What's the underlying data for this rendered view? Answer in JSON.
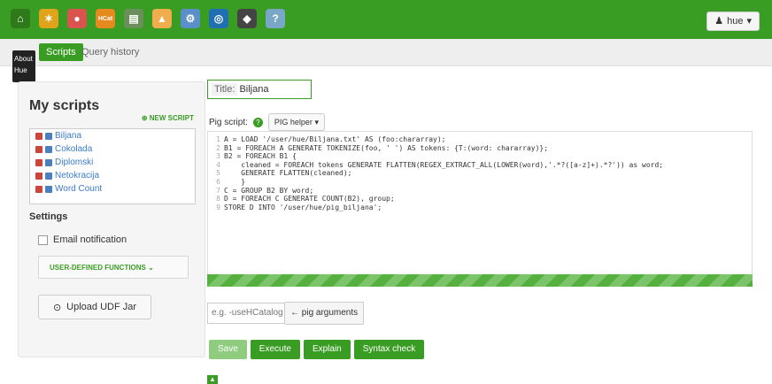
{
  "topbar": {
    "apps": [
      {
        "name": "hue-home-icon",
        "color": "#2e7a1a",
        "glyph": "⌂"
      },
      {
        "name": "beeswax-icon",
        "color": "#e0a31c",
        "glyph": "✶"
      },
      {
        "name": "pig-icon",
        "color": "#d9534f",
        "glyph": "●"
      },
      {
        "name": "hcat-icon",
        "color": "#e58a1e",
        "glyph": "HCat"
      },
      {
        "name": "impala-icon",
        "color": "#6b8f5b",
        "glyph": "▤"
      },
      {
        "name": "file-browser-icon",
        "color": "#f0ad4e",
        "glyph": "▲"
      },
      {
        "name": "job-designer-icon",
        "color": "#5b8fc9",
        "glyph": "⚙"
      },
      {
        "name": "oozie-icon",
        "color": "#1f6fb2",
        "glyph": "◎"
      },
      {
        "name": "job-browser-icon",
        "color": "#444444",
        "glyph": "◆"
      },
      {
        "name": "help-icon",
        "color": "#7aa7c7",
        "glyph": "?"
      }
    ],
    "user_label": "hue"
  },
  "tooltip": {
    "line1": "About",
    "line2": "Hue"
  },
  "subnav": {
    "scripts_tab": "Scripts",
    "history_tab": "Query history"
  },
  "sidebar": {
    "heading": "My scripts",
    "new_script": "NEW SCRIPT",
    "scripts": [
      "Biljana",
      "Cokolada",
      "Diplomski",
      "Netokracija",
      "Word Count"
    ],
    "settings_label": "Settings",
    "email_notification": "Email notification",
    "udf_label": "USER-DEFINED FUNCTIONS",
    "upload_udf": "Upload UDF Jar"
  },
  "editor": {
    "title_label": "Title:",
    "title_value": "Biljana",
    "pig_script_label": "Pig script:",
    "pig_helper": "PIG helper",
    "lines": [
      "A = LOAD '/user/hue/Biljana.txt' AS (foo:chararray);",
      "B1 = FOREACH A GENERATE TOKENIZE(foo, ' ') AS tokens: {T:(word: chararray)};",
      "B2 = FOREACH B1 {",
      "    cleaned = FOREACH tokens GENERATE FLATTEN(REGEX_EXTRACT_ALL(LOWER(word),'.*?([a-z]+).*?')) as word;",
      "    GENERATE FLATTEN(cleaned);",
      "    }",
      "C = GROUP B2 BY word;",
      "D = FOREACH C GENERATE COUNT(B2), group;",
      "STORE D INTO '/user/hue/pig_biljana';"
    ],
    "args_placeholder": "e.g. -useHCatalog",
    "args_button": "pig arguments",
    "buttons": {
      "save": "Save",
      "execute": "Execute",
      "explain": "Explain",
      "syntax_check": "Syntax check"
    }
  },
  "colors": {
    "brand_green": "#3a9d23"
  }
}
